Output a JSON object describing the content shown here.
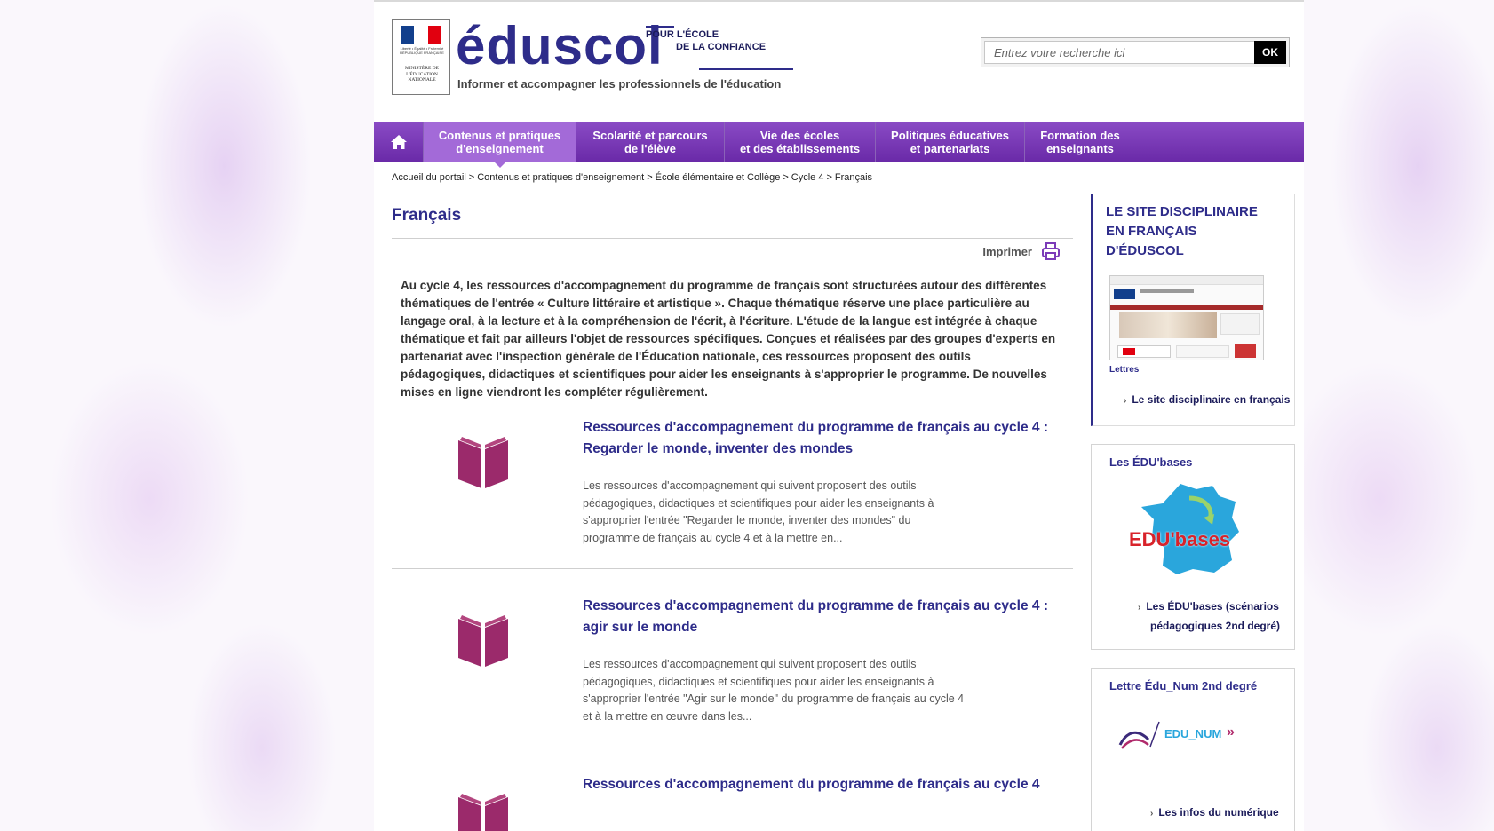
{
  "header": {
    "logo": "éduscol",
    "confiance_line1": "POUR L'ÉCOLE",
    "confiance_line2": "DE LA CONFIANCE",
    "tagline": "Informer et accompagner les professionnels de l'éducation",
    "ministry": "MINISTÈRE DE L'ÉDUCATION NATIONALE",
    "republic": "Liberté • Égalité • Fraternité RÉPUBLIQUE FRANÇAISE"
  },
  "search": {
    "placeholder": "Entrez votre recherche ici",
    "button": "OK"
  },
  "nav": {
    "items": [
      {
        "line1": "Contenus et pratiques",
        "line2": "d'enseignement"
      },
      {
        "line1": "Scolarité et parcours",
        "line2": "de l'élève"
      },
      {
        "line1": "Vie des écoles",
        "line2": "et des établissements"
      },
      {
        "line1": "Politiques éducatives",
        "line2": "et partenariats"
      },
      {
        "line1": "Formation des",
        "line2": "enseignants"
      }
    ]
  },
  "breadcrumb": [
    "Accueil du portail",
    "Contenus et pratiques d'enseignement",
    "École élémentaire et Collège",
    "Cycle 4",
    "Français"
  ],
  "breadcrumb_sep": ">",
  "main": {
    "title": "Français",
    "print_label": "Imprimer",
    "intro": "Au cycle 4, les ressources d'accompagnement du programme de français sont structurées autour des différentes thématiques de l'entrée « Culture littéraire et artistique ». Chaque thématique réserve une place particulière au langage oral, à la lecture et à la compréhension de l'écrit, à l'écriture. L'étude de la langue est intégrée à chaque thématique et fait par ailleurs l'objet de ressources spécifiques. Conçues et réalisées par des groupes d'experts en partenariat avec l'inspection générale de l'Éducation nationale, ces ressources proposent des outils pédagogiques, didactiques et scientifiques pour aider les enseignants à s'approprier le programme. De nouvelles mises en ligne viendront les compléter régulièrement.",
    "resources": [
      {
        "title": "Ressources d'accompagnement du programme de français au cycle 4 : Regarder le monde, inventer des mondes",
        "desc": "Les ressources d'accompagnement qui suivent proposent des outils pédagogiques, didactiques et scientifiques pour aider les enseignants à s'approprier l'entrée \"Regarder le monde, inventer des mondes\" du programme de français au cycle 4 et à la mettre en..."
      },
      {
        "title": "Ressources d'accompagnement du programme de français au cycle 4 : agir sur le monde",
        "desc": "Les ressources d'accompagnement qui suivent proposent des outils pédagogiques, didactiques et scientifiques pour aider les enseignants à s'approprier l'entrée \"Agir sur le monde\" du programme de français au cycle 4 et à la mettre en œuvre dans les..."
      },
      {
        "title": "Ressources d'accompagnement du programme de français au cycle 4",
        "desc": ""
      }
    ]
  },
  "sidebar": {
    "box1": {
      "title": "Le site disciplinaire en français d'éduscol",
      "caption": "Lettres",
      "link": "Le site disciplinaire en français"
    },
    "box2": {
      "title": "Les ÉDU'bases",
      "logo": "EDU'bases",
      "link_line1": "Les ÉDU'bases (scénarios",
      "link_line2": "pédagogiques 2nd degré)"
    },
    "box3": {
      "title": "Lettre Édu_Num 2nd degré",
      "logo": "EDU_NUM",
      "link": "Les infos du numérique"
    }
  },
  "colors": {
    "brand": "#2e2c8a",
    "nav": "#7b3bb8",
    "nav_active": "#a36ad8",
    "book": "#9b2a6b"
  }
}
